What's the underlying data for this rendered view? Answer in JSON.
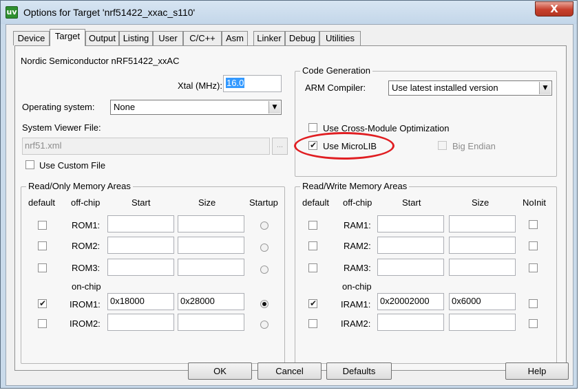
{
  "window": {
    "title": "Options for Target 'nrf51422_xxac_s110'",
    "app_icon": "uv",
    "close_glyph": "X"
  },
  "tabs": [
    "Device",
    "Target",
    "Output",
    "Listing",
    "User",
    "C/C++",
    "Asm",
    "Linker",
    "Debug",
    "Utilities"
  ],
  "active_tab": "Target",
  "device_name": "Nordic Semiconductor nRF51422_xxAC",
  "xtal": {
    "label": "Xtal (MHz):",
    "value": "16.0"
  },
  "os": {
    "label": "Operating system:",
    "value": "None",
    "arrow": "▼"
  },
  "svd": {
    "label": "System Viewer File:",
    "value": "nrf51.xml",
    "browse": "..."
  },
  "use_custom_file": {
    "label": "Use Custom File",
    "checked": false
  },
  "code_generation": {
    "title": "Code Generation",
    "compiler_label": "ARM Compiler:",
    "compiler_value": "Use latest installed version",
    "arrow": "▼",
    "cross_module": {
      "label": "Use Cross-Module Optimization",
      "checked": false
    },
    "microlib": {
      "label": "Use MicroLIB",
      "checked": true
    },
    "big_endian": {
      "label": "Big Endian",
      "checked": false,
      "disabled": true
    }
  },
  "check_mark": "✔",
  "ro_memory": {
    "title": "Read/Only Memory Areas",
    "headers": {
      "default": "default",
      "offchip": "off-chip",
      "start": "Start",
      "size": "Size",
      "startup": "Startup"
    },
    "onchip_label": "on-chip",
    "rows": [
      {
        "name": "ROM1:",
        "default": false,
        "start": "",
        "size": "",
        "startup": false
      },
      {
        "name": "ROM2:",
        "default": false,
        "start": "",
        "size": "",
        "startup": false
      },
      {
        "name": "ROM3:",
        "default": false,
        "start": "",
        "size": "",
        "startup": false
      },
      {
        "name": "IROM1:",
        "default": true,
        "start": "0x18000",
        "size": "0x28000",
        "startup": true
      },
      {
        "name": "IROM2:",
        "default": false,
        "start": "",
        "size": "",
        "startup": false
      }
    ]
  },
  "rw_memory": {
    "title": "Read/Write Memory Areas",
    "headers": {
      "default": "default",
      "offchip": "off-chip",
      "start": "Start",
      "size": "Size",
      "noinit": "NoInit"
    },
    "onchip_label": "on-chip",
    "rows": [
      {
        "name": "RAM1:",
        "default": false,
        "start": "",
        "size": "",
        "noinit": false
      },
      {
        "name": "RAM2:",
        "default": false,
        "start": "",
        "size": "",
        "noinit": false
      },
      {
        "name": "RAM3:",
        "default": false,
        "start": "",
        "size": "",
        "noinit": false
      },
      {
        "name": "IRAM1:",
        "default": true,
        "start": "0x20002000",
        "size": "0x6000",
        "noinit": false
      },
      {
        "name": "IRAM2:",
        "default": false,
        "start": "",
        "size": "",
        "noinit": false
      }
    ]
  },
  "buttons": {
    "ok": "OK",
    "cancel": "Cancel",
    "defaults": "Defaults",
    "help": "Help"
  },
  "colors": {
    "annotation": "#e01e22",
    "selection": "#3399ff"
  }
}
